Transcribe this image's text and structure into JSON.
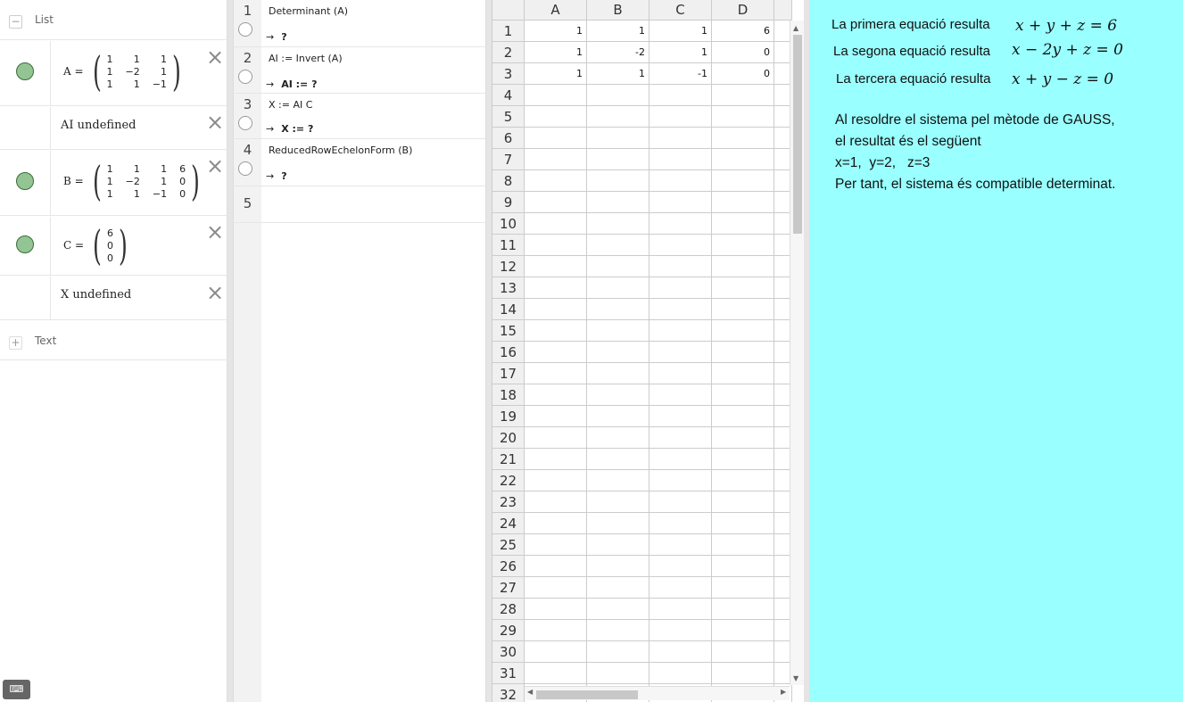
{
  "algebra": {
    "header_label": "List",
    "text_group_label": "Text",
    "objects": {
      "A": {
        "name": "A =",
        "rows": [
          [
            "1",
            "1",
            "1"
          ],
          [
            "1",
            "−2",
            "1"
          ],
          [
            "1",
            "1",
            "−1"
          ]
        ]
      },
      "AI": {
        "text": "AI undefined"
      },
      "B": {
        "name": "B =",
        "rows": [
          [
            "1",
            "1",
            "1",
            "6"
          ],
          [
            "1",
            "−2",
            "1",
            "0"
          ],
          [
            "1",
            "1",
            "−1",
            "0"
          ]
        ]
      },
      "C": {
        "name": "C =",
        "rows": [
          [
            "6"
          ],
          [
            "0"
          ],
          [
            "0"
          ]
        ]
      },
      "X": {
        "text": "X undefined"
      }
    },
    "colors": {
      "visible_dot": "#93c493"
    },
    "icons": {
      "collapse": "minus-icon",
      "delete": "close-icon",
      "add": "plus-icon",
      "keyboard": "keyboard-icon"
    }
  },
  "cas": {
    "rows": [
      {
        "num": "1",
        "input": "Determinant (A)",
        "output": "?"
      },
      {
        "num": "2",
        "input": "AI := Invert (A)",
        "output": "AI := ?"
      },
      {
        "num": "3",
        "input": "X := AI C",
        "output": "X := ?"
      },
      {
        "num": "4",
        "input": "ReducedRowEchelonForm (B)",
        "output": "?"
      },
      {
        "num": "5",
        "input": "",
        "output": ""
      }
    ],
    "arrow": "→"
  },
  "spreadsheet": {
    "columns": [
      "A",
      "B",
      "C",
      "D"
    ],
    "row_numbers": [
      "1",
      "2",
      "3",
      "4",
      "5",
      "6",
      "7",
      "8",
      "9",
      "10",
      "11",
      "12",
      "13",
      "14",
      "15",
      "16",
      "17",
      "18",
      "19",
      "20",
      "21",
      "22",
      "23",
      "24",
      "25",
      "26",
      "27",
      "28",
      "29",
      "30",
      "31",
      "32"
    ],
    "cells": [
      [
        "1",
        "1",
        "1",
        "6"
      ],
      [
        "1",
        "-2",
        "1",
        "0"
      ],
      [
        "1",
        "1",
        "-1",
        "0"
      ]
    ]
  },
  "graphics": {
    "background": "#99ffff",
    "equations": [
      {
        "label": "La primera equació resulta",
        "math": "x + y + z = 6"
      },
      {
        "label": "La segona equació resulta",
        "math": "x − 2y + z = 0"
      },
      {
        "label": "La tercera equació resulta",
        "math": "x + y − z = 0"
      }
    ],
    "paragraph": [
      "Al resoldre el sistema pel mètode de GAUSS,",
      "el resultat és el següent",
      "x=1,  y=2,   z=3",
      "Per tant, el sistema és compatible determinat."
    ]
  }
}
